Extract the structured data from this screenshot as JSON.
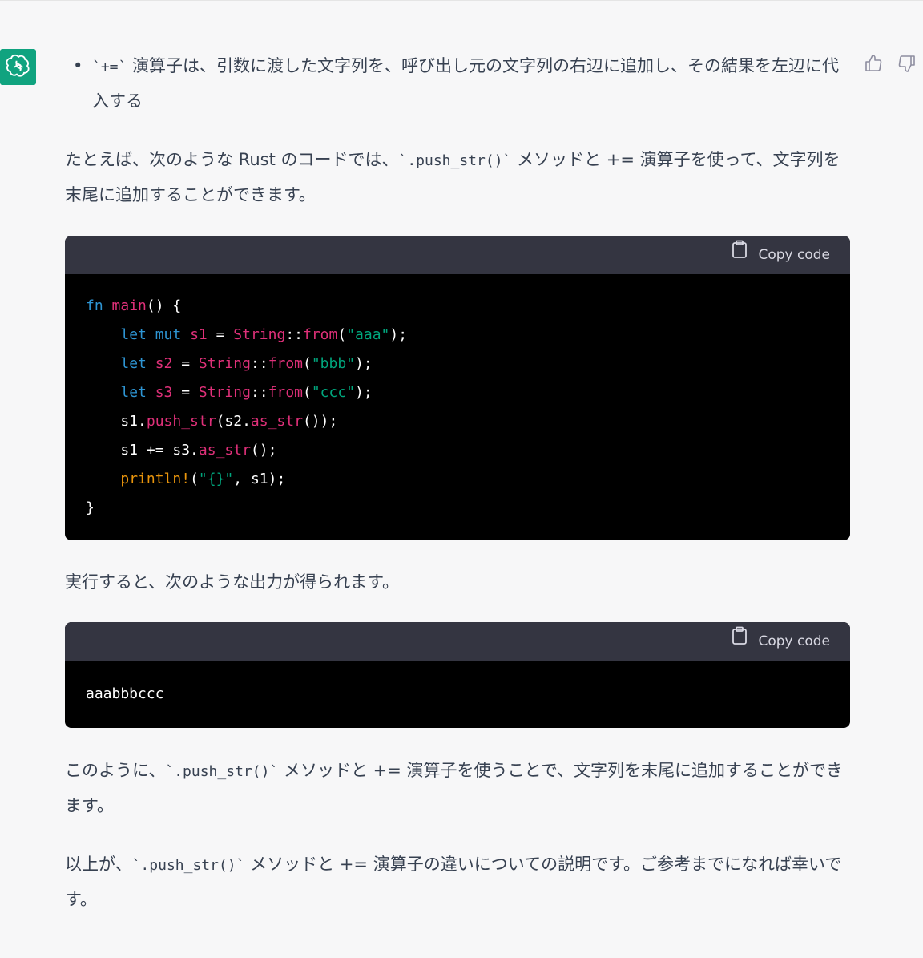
{
  "colors": {
    "avatar_bg": "#10a37f",
    "code_header_bg": "#343541",
    "code_bg": "#000000",
    "keyword": "#2e95d3",
    "ident": "#df3079",
    "string": "#00a67d",
    "macro": "#e9950c"
  },
  "icons": {
    "avatar": "openai-logo-icon",
    "like": "thumbs-up-icon",
    "dislike": "thumbs-down-icon",
    "copy": "clipboard-icon"
  },
  "message": {
    "bullet": {
      "marker": "•",
      "code": "`+=`",
      "text": " 演算子は、引数に渡した文字列を、呼び出し元の文字列の右辺に追加し、その結果を左辺に代入する"
    },
    "intro": {
      "before": "たとえば、次のような Rust のコードでは、",
      "code": "`.push_str()`",
      "after": " メソッドと += 演算子を使って、文字列を末尾に追加することができます。"
    },
    "code1": {
      "copy_label": "Copy code",
      "lines": [
        [
          [
            "k-blue",
            "fn"
          ],
          [
            "k-punc",
            " "
          ],
          [
            "k-red",
            "main"
          ],
          [
            "k-punc",
            "() {"
          ]
        ],
        [
          [
            "k-punc",
            "    "
          ],
          [
            "k-blue",
            "let"
          ],
          [
            "k-punc",
            " "
          ],
          [
            "k-blue",
            "mut"
          ],
          [
            "k-punc",
            " "
          ],
          [
            "k-red",
            "s1"
          ],
          [
            "k-punc",
            " = "
          ],
          [
            "k-red",
            "String"
          ],
          [
            "k-punc",
            "::"
          ],
          [
            "k-red",
            "from"
          ],
          [
            "k-punc",
            "("
          ],
          [
            "k-str",
            "\"aaa\""
          ],
          [
            "k-punc",
            ");"
          ]
        ],
        [
          [
            "k-punc",
            "    "
          ],
          [
            "k-blue",
            "let"
          ],
          [
            "k-punc",
            " "
          ],
          [
            "k-red",
            "s2"
          ],
          [
            "k-punc",
            " = "
          ],
          [
            "k-red",
            "String"
          ],
          [
            "k-punc",
            "::"
          ],
          [
            "k-red",
            "from"
          ],
          [
            "k-punc",
            "("
          ],
          [
            "k-str",
            "\"bbb\""
          ],
          [
            "k-punc",
            ");"
          ]
        ],
        [
          [
            "k-punc",
            "    "
          ],
          [
            "k-blue",
            "let"
          ],
          [
            "k-punc",
            " "
          ],
          [
            "k-red",
            "s3"
          ],
          [
            "k-punc",
            " = "
          ],
          [
            "k-red",
            "String"
          ],
          [
            "k-punc",
            "::"
          ],
          [
            "k-red",
            "from"
          ],
          [
            "k-punc",
            "("
          ],
          [
            "k-str",
            "\"ccc\""
          ],
          [
            "k-punc",
            ");"
          ]
        ],
        [
          [
            "k-punc",
            "    s1."
          ],
          [
            "k-red",
            "push_str"
          ],
          [
            "k-punc",
            "(s2."
          ],
          [
            "k-red",
            "as_str"
          ],
          [
            "k-punc",
            "());"
          ]
        ],
        [
          [
            "k-punc",
            "    s1 += s3."
          ],
          [
            "k-red",
            "as_str"
          ],
          [
            "k-punc",
            "();"
          ]
        ],
        [
          [
            "k-punc",
            "    "
          ],
          [
            "k-orange",
            "println!"
          ],
          [
            "k-punc",
            "("
          ],
          [
            "k-str",
            "\"{}\""
          ],
          [
            "k-punc",
            ", s1);"
          ]
        ],
        [
          [
            "k-punc",
            "}"
          ]
        ]
      ]
    },
    "after_code1": "実行すると、次のような出力が得られます。",
    "code2": {
      "copy_label": "Copy code",
      "output": "aaabbbccc"
    },
    "summary": {
      "before": "このように、",
      "code": "`.push_str()`",
      "after": " メソッドと += 演算子を使うことで、文字列を末尾に追加することができます。"
    },
    "closing": {
      "before": "以上が、",
      "code": "`.push_str()`",
      "after": " メソッドと += 演算子の違いについての説明です。ご参考までになれば幸いです。"
    }
  }
}
